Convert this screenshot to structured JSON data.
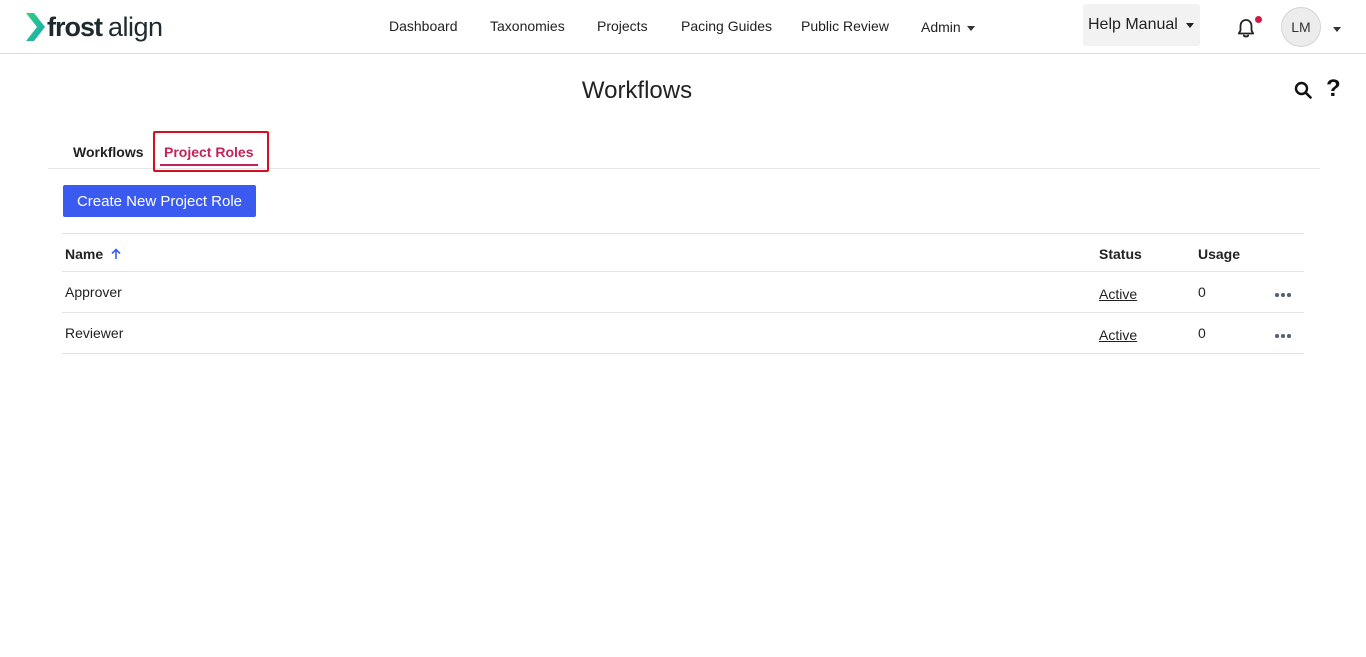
{
  "brand": {
    "name_bold": "frost",
    "name_light": "align"
  },
  "nav": [
    {
      "label": "Dashboard"
    },
    {
      "label": "Taxonomies"
    },
    {
      "label": "Projects"
    },
    {
      "label": "Pacing Guides"
    },
    {
      "label": "Public Review"
    },
    {
      "label": "Admin"
    }
  ],
  "help_manual": {
    "label": "Help Manual"
  },
  "user": {
    "initials": "LM"
  },
  "page": {
    "title": "Workflows"
  },
  "tabs": [
    {
      "label": "Workflows",
      "active": false
    },
    {
      "label": "Project Roles",
      "active": true
    }
  ],
  "actions": {
    "create_label": "Create New Project Role"
  },
  "table": {
    "columns": {
      "name": "Name",
      "status": "Status",
      "usage": "Usage"
    },
    "rows": [
      {
        "name": "Approver",
        "status": "Active",
        "usage": "0"
      },
      {
        "name": "Reviewer",
        "status": "Active",
        "usage": "0"
      }
    ]
  },
  "colors": {
    "accent": "#c2245a",
    "primary_button": "#3b5bf0",
    "logo_green": "#2fd07a",
    "notification_dot": "#d11a4a",
    "highlight": "#d60f1e"
  },
  "icons": {
    "logo": "chevron-mark-icon",
    "bell": "bell-icon",
    "search": "search-icon",
    "help": "question-mark-icon",
    "sort": "arrow-up-icon",
    "more": "more-horizontal-icon"
  }
}
